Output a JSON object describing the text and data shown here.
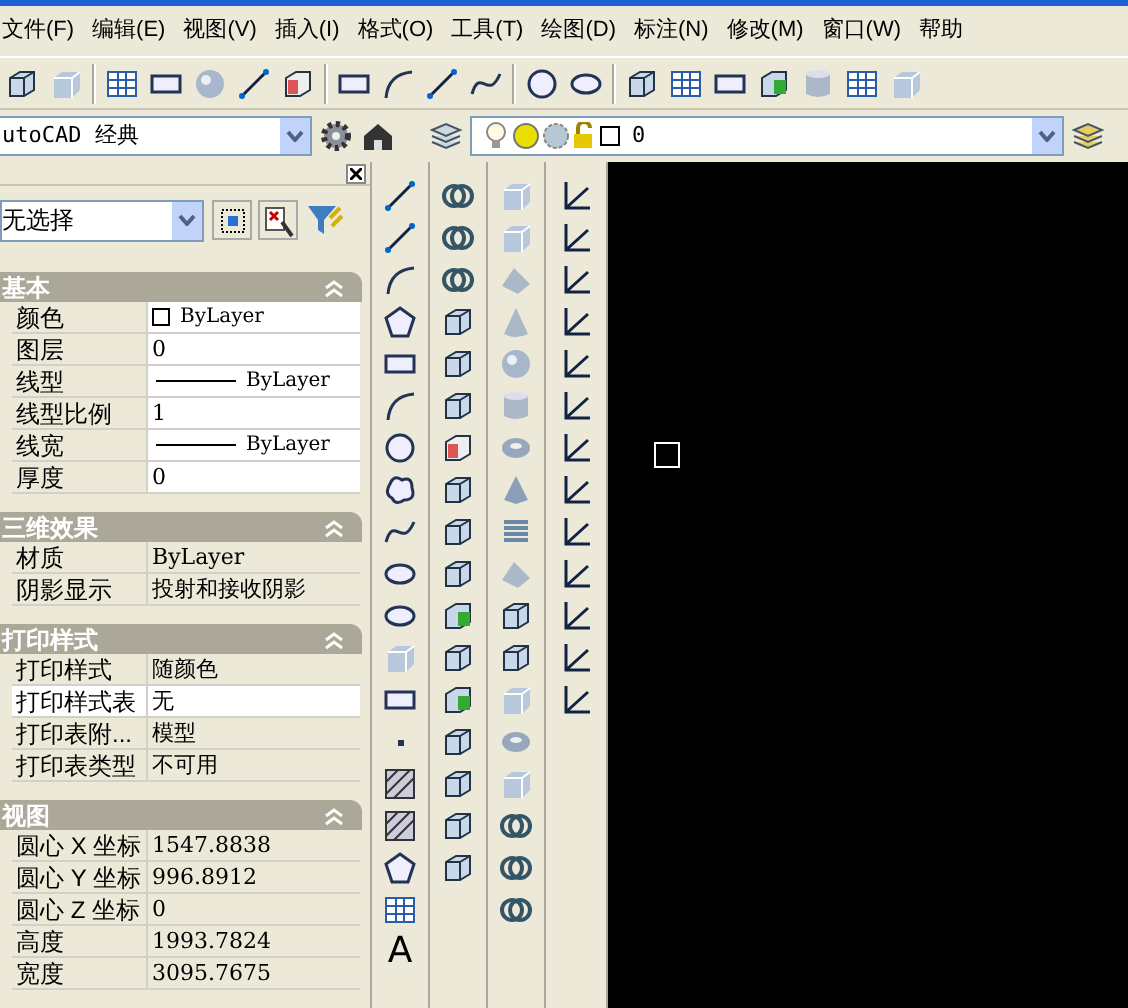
{
  "menu": [
    {
      "label": "文件(F)"
    },
    {
      "label": "编辑(E)"
    },
    {
      "label": "视图(V)"
    },
    {
      "label": "插入(I)"
    },
    {
      "label": "格式(O)"
    },
    {
      "label": "工具(T)"
    },
    {
      "label": "绘图(D)"
    },
    {
      "label": "标注(N)"
    },
    {
      "label": "修改(M)"
    },
    {
      "label": "窗口(W)"
    },
    {
      "label": "帮助"
    }
  ],
  "workspace": {
    "value": "utoCAD 经典"
  },
  "layer": {
    "value": "0"
  },
  "properties": {
    "selection": "无选择",
    "sections": [
      {
        "title": "基本",
        "expanded": true,
        "rows": [
          {
            "label": "颜色",
            "value": "ByLayer",
            "kind": "swatch",
            "selected": false
          },
          {
            "label": "图层",
            "value": "0",
            "kind": "plain",
            "selected": false
          },
          {
            "label": "线型",
            "value": "ByLayer",
            "kind": "linetype",
            "selected": false
          },
          {
            "label": "线型比例",
            "value": "1",
            "kind": "plain",
            "selected": false
          },
          {
            "label": "线宽",
            "value": "ByLayer",
            "kind": "linetype",
            "selected": false
          },
          {
            "label": "厚度",
            "value": "0",
            "kind": "plain",
            "selected": false
          }
        ]
      },
      {
        "title": "三维效果",
        "expanded": true,
        "rows": [
          {
            "label": "材质",
            "value": "ByLayer",
            "kind": "plain",
            "selected": false
          },
          {
            "label": "阴影显示",
            "value": "投射和接收阴影",
            "kind": "plain",
            "selected": false
          }
        ]
      },
      {
        "title": "打印样式",
        "expanded": true,
        "rows": [
          {
            "label": "打印样式",
            "value": "随颜色",
            "kind": "plain",
            "selected": false
          },
          {
            "label": "打印样式表",
            "value": "无",
            "kind": "plain",
            "selected": true
          },
          {
            "label": "打印表附...",
            "value": "模型",
            "kind": "plain",
            "selected": false
          },
          {
            "label": "打印表类型",
            "value": "不可用",
            "kind": "plain",
            "selected": false
          }
        ]
      },
      {
        "title": "视图",
        "expanded": true,
        "rows": [
          {
            "label": "圆心 X 坐标",
            "value": "1547.8838",
            "kind": "plain",
            "selected": false
          },
          {
            "label": "圆心 Y 坐标",
            "value": "996.8912",
            "kind": "plain",
            "selected": false
          },
          {
            "label": "圆心 Z 坐标",
            "value": "0",
            "kind": "plain",
            "selected": false
          },
          {
            "label": "高度",
            "value": "1993.7824",
            "kind": "plain",
            "selected": false
          },
          {
            "label": "宽度",
            "value": "3095.7675",
            "kind": "plain",
            "selected": false
          }
        ]
      }
    ]
  },
  "draw_toolbar": {
    "text_tool": "A"
  }
}
